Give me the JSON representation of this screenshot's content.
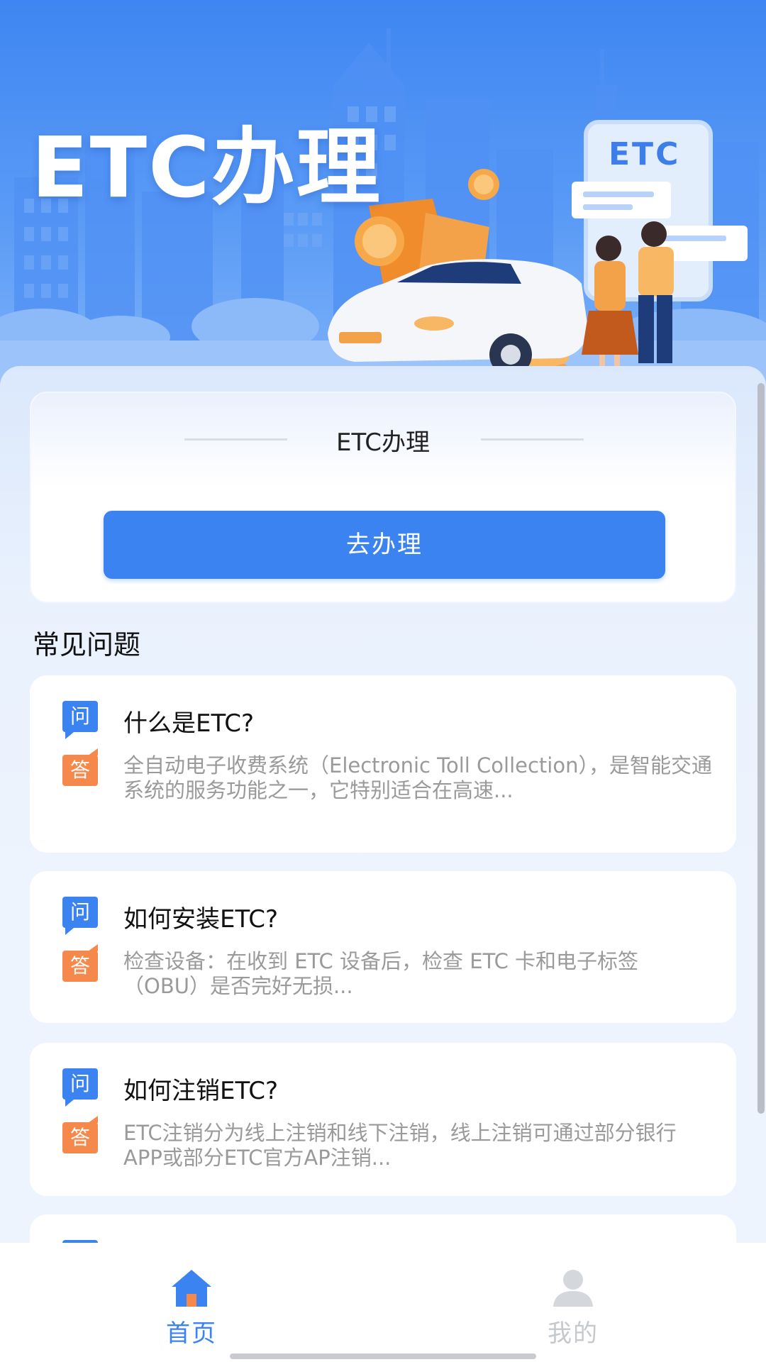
{
  "banner": {
    "title": "ETC办理",
    "card_label": "ETC"
  },
  "service": {
    "heading": "ETC办理",
    "button_label": "去办理"
  },
  "faq": {
    "section_title": "常见问题",
    "question_badge": "问",
    "answer_badge": "答",
    "items": [
      {
        "question": "什么是ETC?",
        "answer": "全自动电子收费系统（Electronic Toll Collection），是智能交通系统的服务功能之一，它特别适合在高速..."
      },
      {
        "question": "如何安装ETC?",
        "answer": "检查设备：在收到 ETC 设备后，检查 ETC 卡和电子标签（OBU）是否完好无损..."
      },
      {
        "question": "如何注销ETC?",
        "answer": "ETC注销分为线上注销和线下注销，线上注销可通过部分银行APP或部分ETC官方AP注销..."
      }
    ]
  },
  "tabbar": {
    "home": {
      "label": "首页",
      "icon": "home-icon",
      "active": true
    },
    "mine": {
      "label": "我的",
      "icon": "user-icon",
      "active": false
    }
  },
  "colors": {
    "primary": "#3a83f1",
    "answer_badge": "#f5894b",
    "banner_blue": "#4a8df3",
    "muted_text": "#9a9a9a",
    "inactive_tab": "#c5c8cc"
  }
}
